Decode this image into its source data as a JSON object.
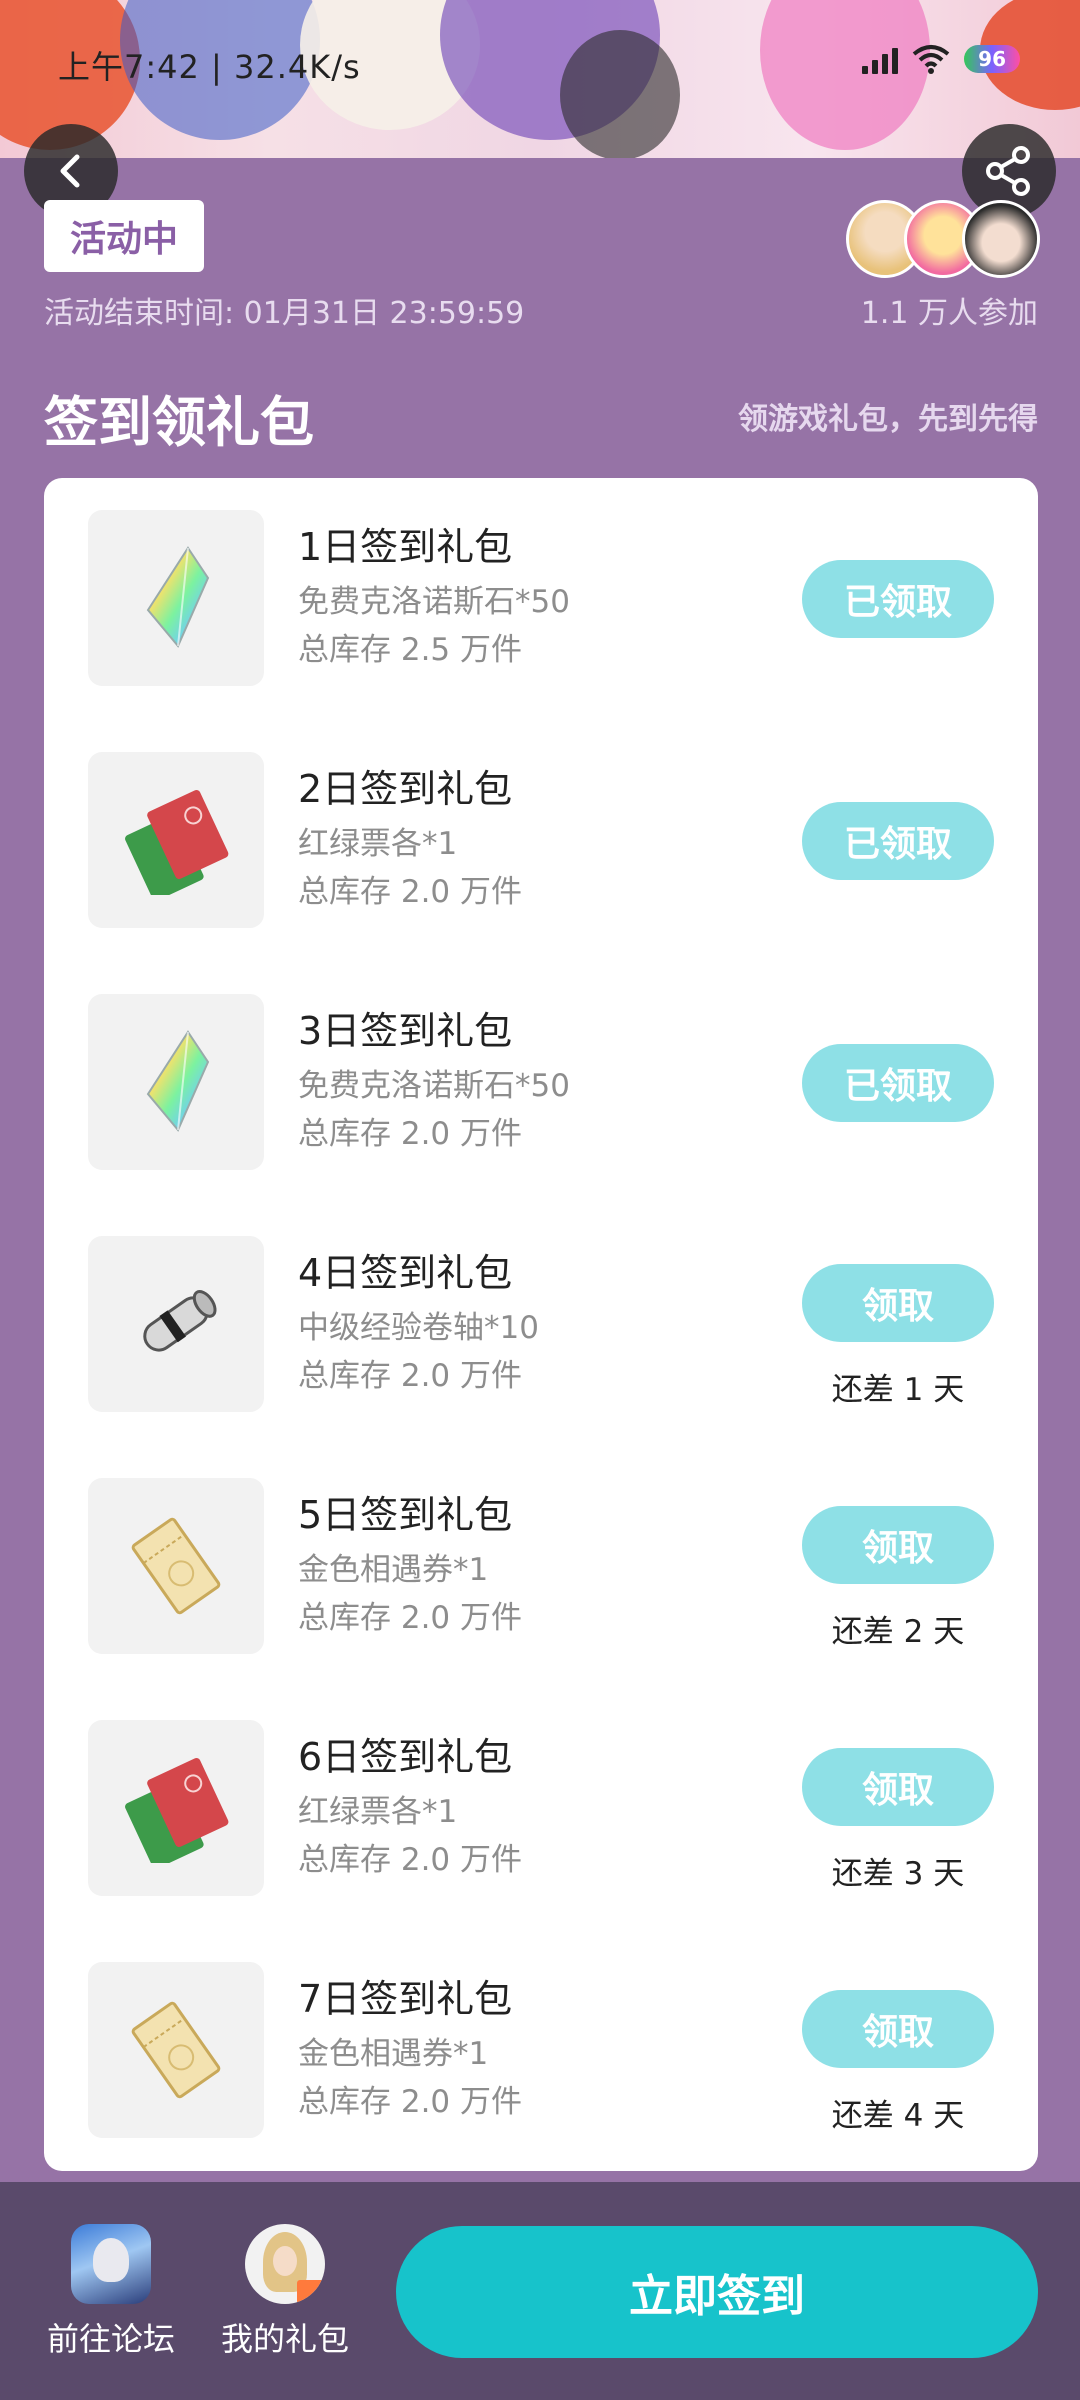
{
  "status_bar": {
    "time": "上午7:42 | 32.4K/s",
    "battery": "96"
  },
  "header": {
    "badge": "活动中",
    "end_time": "活动结束时间: 01月31日 23:59:59",
    "participants": "1.1 万人参加"
  },
  "section": {
    "title": "签到领礼包",
    "tip": "领游戏礼包，先到先得"
  },
  "gifts": [
    {
      "name": "1日签到礼包",
      "desc": "免费克洛诺斯石*50",
      "stock": "总库存 2.5 万件",
      "button": "已领取",
      "icon": "rainbow-crystal-icon"
    },
    {
      "name": "2日签到礼包",
      "desc": "红绿票各*1",
      "stock": "总库存 2.0 万件",
      "button": "已领取",
      "icon": "red-green-ticket-icon"
    },
    {
      "name": "3日签到礼包",
      "desc": "免费克洛诺斯石*50",
      "stock": "总库存 2.0 万件",
      "button": "已领取",
      "icon": "rainbow-crystal-icon"
    },
    {
      "name": "4日签到礼包",
      "desc": "中级经验卷轴*10",
      "stock": "总库存 2.0 万件",
      "button": "领取",
      "remain": "还差 1 天",
      "icon": "scroll-icon"
    },
    {
      "name": "5日签到礼包",
      "desc": "金色相遇券*1",
      "stock": "总库存 2.0 万件",
      "button": "领取",
      "remain": "还差 2 天",
      "icon": "gold-ticket-icon"
    },
    {
      "name": "6日签到礼包",
      "desc": "红绿票各*1",
      "stock": "总库存 2.0 万件",
      "button": "领取",
      "remain": "还差 3 天",
      "icon": "red-green-ticket-icon"
    },
    {
      "name": "7日签到礼包",
      "desc": "金色相遇券*1",
      "stock": "总库存 2.0 万件",
      "button": "领取",
      "remain": "还差 4 天",
      "icon": "gold-ticket-icon"
    }
  ],
  "bottom": {
    "forum": "前往论坛",
    "my_gifts": "我的礼包",
    "signin": "立即签到"
  },
  "colors": {
    "background": "#9673a6",
    "accent": "#17c3cb",
    "button_light": "#8ee0e6",
    "bottom_bar": "#5a4a6b"
  }
}
